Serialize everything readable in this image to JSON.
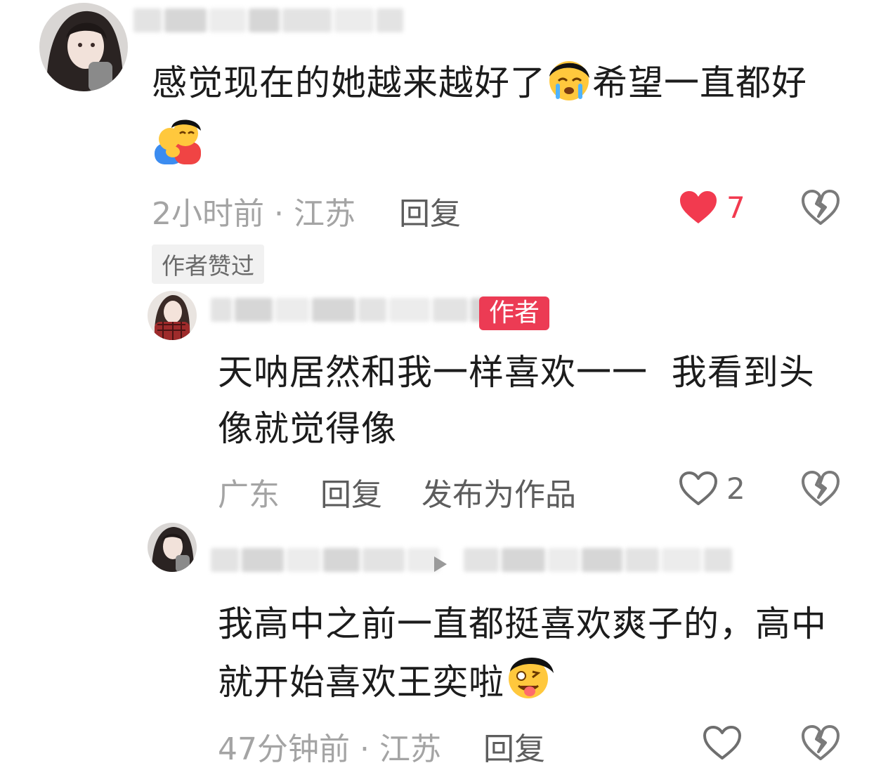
{
  "comments": [
    {
      "text": "感觉现在的她越来越好了",
      "text2": "希望一直都好",
      "emoji1": "crying-emoji",
      "emoji2": "hug-emoji",
      "time_location": "2小时前 · 江苏",
      "reply_label": "回复",
      "like_count": "7",
      "liked": true,
      "badge": "作者赞过"
    },
    {
      "author_badge": "作者",
      "text_line1": "天呐居然和我一样喜欢一一  我看到头",
      "text_line2": "像就觉得像",
      "location": "广东",
      "reply_label": "回复",
      "publish_label": "发布为作品",
      "like_count": "2",
      "liked": false
    },
    {
      "text_line1": "我高中之前一直都挺喜欢爽子的，高中",
      "text_line2": "就开始喜欢王奕啦",
      "emoji": "tongue-out-emoji",
      "time_location": "47分钟前 · 江苏",
      "reply_label": "回复",
      "liked": false
    }
  ],
  "colors": {
    "like_red": "#f23a4f",
    "author_red": "#ec3b54",
    "meta_gray": "#a4a4a4"
  }
}
